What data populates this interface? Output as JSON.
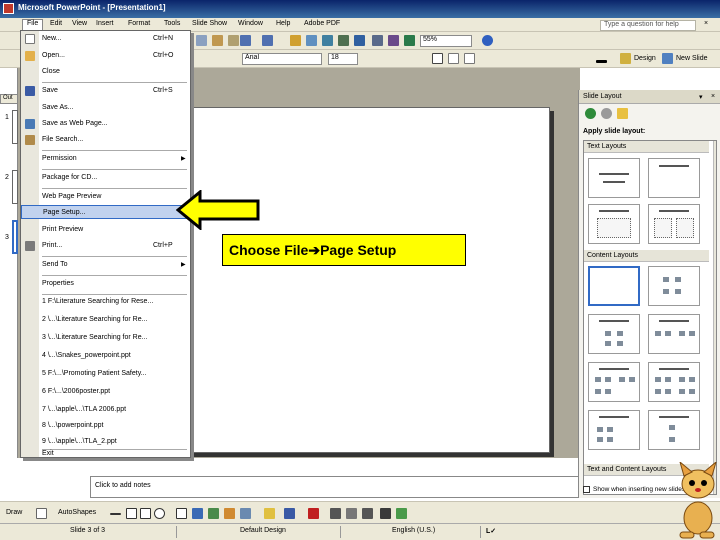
{
  "window": {
    "title": "Microsoft PowerPoint - [Presentation1]"
  },
  "menubar": {
    "items": [
      "File",
      "Edit",
      "View",
      "Insert",
      "Format",
      "Tools",
      "Slide Show",
      "Window",
      "Help",
      "Adobe PDF"
    ],
    "help_placeholder": "Type a question for help",
    "close_glyph": "×"
  },
  "toolbar_standard": {
    "zoom": "55%"
  },
  "toolbar_formatting": {
    "font": "Arial",
    "size": "18",
    "design_label": "Design",
    "new_slide_label": "New Slide"
  },
  "outline": {
    "tab_label": "Out",
    "slide_numbers": [
      "1",
      "2",
      "3"
    ]
  },
  "file_menu": {
    "items": [
      {
        "label": "New...",
        "shortcut": "Ctrl+N"
      },
      {
        "label": "Open...",
        "shortcut": "Ctrl+O"
      },
      {
        "label": "Close",
        "shortcut": ""
      },
      {
        "label": "Save",
        "shortcut": "Ctrl+S"
      },
      {
        "label": "Save As...",
        "shortcut": ""
      },
      {
        "label": "Save as Web Page...",
        "shortcut": ""
      },
      {
        "label": "File Search...",
        "shortcut": ""
      },
      {
        "label": "Permission",
        "shortcut": "",
        "submenu": true
      },
      {
        "label": "Package for CD...",
        "shortcut": ""
      },
      {
        "label": "Web Page Preview",
        "shortcut": ""
      },
      {
        "label": "Page Setup...",
        "shortcut": ""
      },
      {
        "label": "Print Preview",
        "shortcut": ""
      },
      {
        "label": "Print...",
        "shortcut": "Ctrl+P"
      },
      {
        "label": "Send To",
        "shortcut": "",
        "submenu": true
      },
      {
        "label": "Properties",
        "shortcut": ""
      },
      {
        "label": "1 F:\\Literature Searching for Rese...",
        "shortcut": ""
      },
      {
        "label": "2 \\...\\Literature Searching for Re...",
        "shortcut": ""
      },
      {
        "label": "3 \\...\\Literature Searching for Re...",
        "shortcut": ""
      },
      {
        "label": "4 \\...\\Snakes_powerpoint.ppt",
        "shortcut": ""
      },
      {
        "label": "5 F:\\...\\Promoting Patient Safety...",
        "shortcut": ""
      },
      {
        "label": "6 F:\\...\\2006poster.ppt",
        "shortcut": ""
      },
      {
        "label": "7 \\...\\apple\\...\\TLA 2006.ppt",
        "shortcut": ""
      },
      {
        "label": "8 \\...\\powerpoint.ppt",
        "shortcut": ""
      },
      {
        "label": "9 \\...\\apple\\...\\TLA_2.ppt",
        "shortcut": ""
      },
      {
        "label": "Exit",
        "shortcut": ""
      }
    ]
  },
  "callout": {
    "prefix": "Choose File",
    "arrow_glyph": "➔",
    "suffix": "Page Setup"
  },
  "notes": {
    "placeholder": "Click to add notes"
  },
  "task_pane": {
    "title": "Slide Layout",
    "apply_label": "Apply slide layout:",
    "sections": [
      "Text Layouts",
      "Content Layouts",
      "Text and Content Layouts"
    ],
    "show_when_inserting": "Show when inserting new slides"
  },
  "drawbar": {
    "draw_label": "Draw",
    "autoshapes_label": "AutoShapes"
  },
  "status": {
    "slide": "Slide 3 of 3",
    "design": "Default Design",
    "language": "English (U.S.)"
  },
  "colors": {
    "title_bar": "#0a246a",
    "chrome": "#ece9d8",
    "menu_highlight": "#c1d2ee",
    "callout_fill": "#ffff00"
  }
}
